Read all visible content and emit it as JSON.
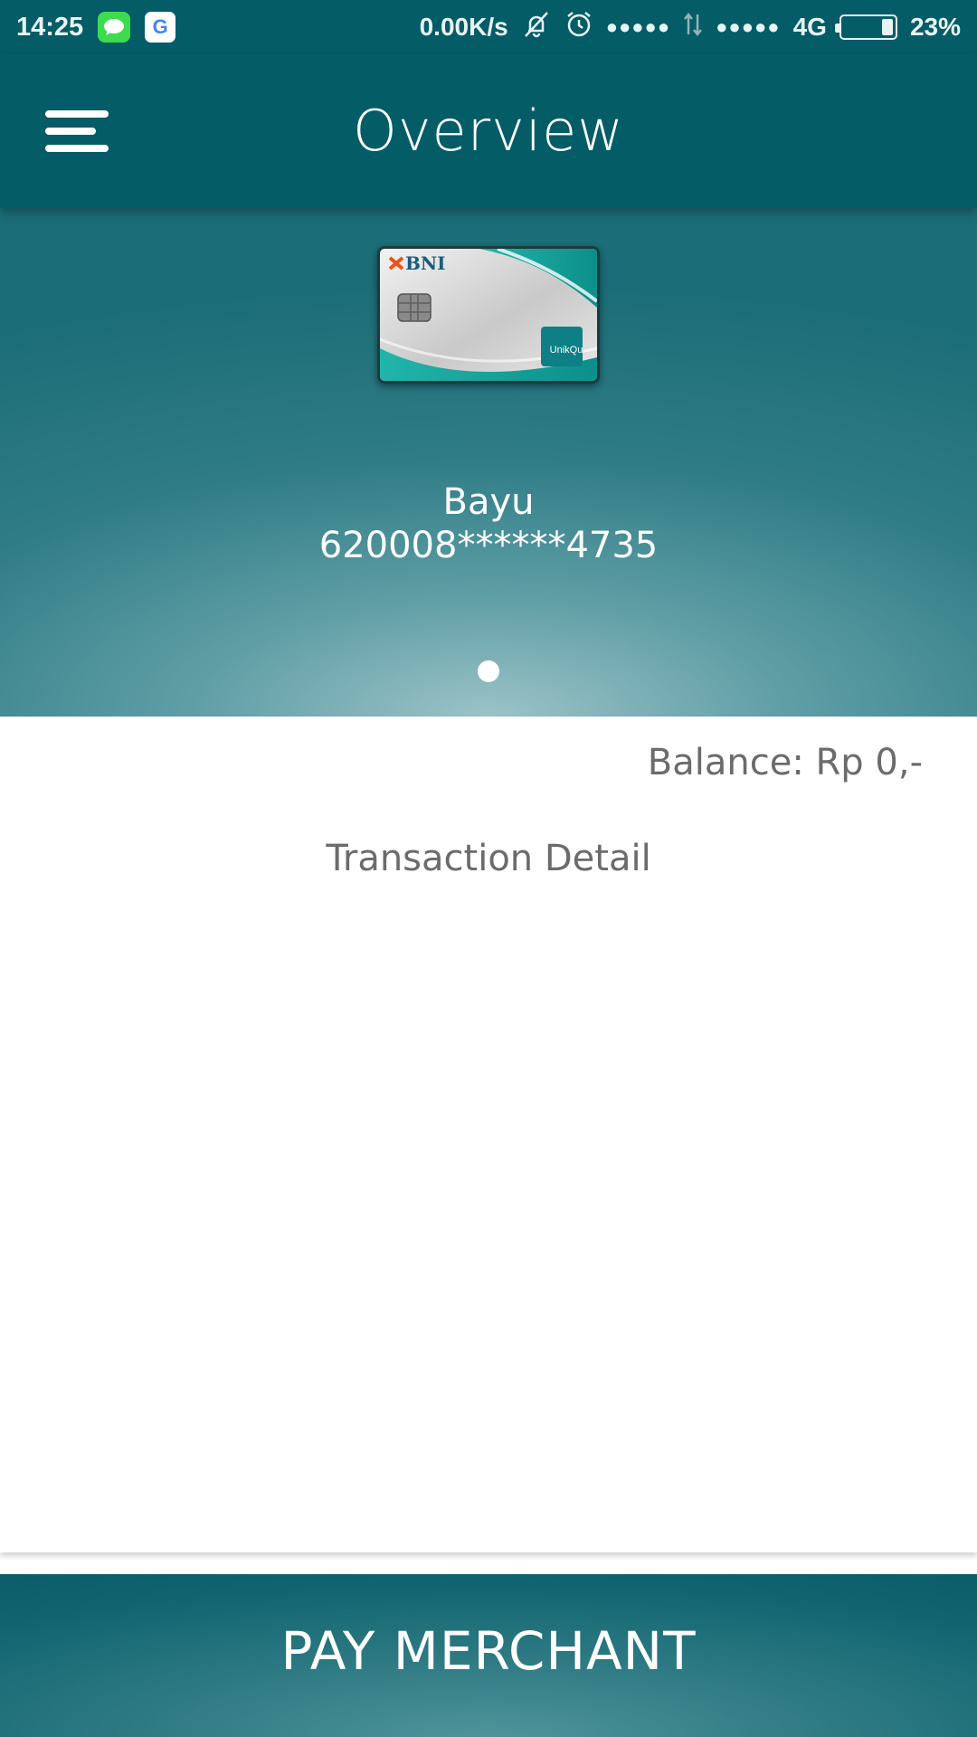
{
  "status_bar": {
    "time": "14:25",
    "net_speed": "0.00K/s",
    "sim1_signal": "●●●●●",
    "sim2_signal": "●●●●●",
    "network": "4G",
    "battery": "23%",
    "battery_level": 0.23,
    "icons": [
      "message-icon",
      "google-icon",
      "vibrate-off-icon",
      "alarm-icon",
      "signal-icon",
      "data-arrows-icon",
      "battery-icon"
    ]
  },
  "app_bar": {
    "title": "Overview",
    "menu_icon": "hamburger-menu-icon"
  },
  "card": {
    "bank": "BNI",
    "product": "UnikQu",
    "holder_name": "Bayu",
    "number": "620008******4735"
  },
  "pager": {
    "pages": 1,
    "active": 0
  },
  "account": {
    "balance": "Balance: Rp 0,-",
    "transaction_title": "Transaction Detail"
  },
  "actions": {
    "pay_merchant": "PAY MERCHANT"
  },
  "colors": {
    "primary": "#035c66",
    "accent": "#1aa39a",
    "text_muted": "#6b6b6b",
    "bni_orange": "#e8541c"
  }
}
